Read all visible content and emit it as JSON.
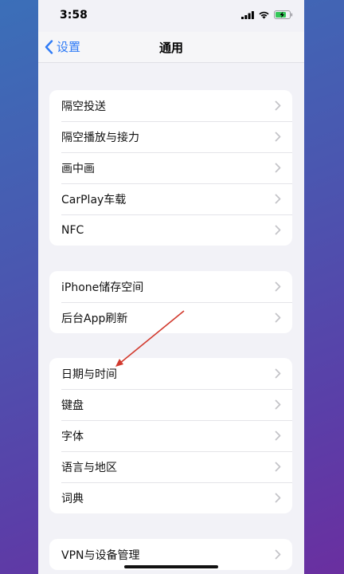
{
  "status_bar": {
    "time": "3:58"
  },
  "nav": {
    "back_label": "设置",
    "title": "通用"
  },
  "groups": [
    {
      "items": [
        "隔空投送",
        "隔空播放与接力",
        "画中画",
        "CarPlay车载",
        "NFC"
      ]
    },
    {
      "items": [
        "iPhone储存空间",
        "后台App刷新"
      ]
    },
    {
      "items": [
        "日期与时间",
        "键盘",
        "字体",
        "语言与地区",
        "词典"
      ]
    },
    {
      "items": [
        "VPN与设备管理"
      ]
    }
  ],
  "colors": {
    "accent": "#2f7bf6",
    "annotation_arrow": "#d23a2e",
    "battery": "#34c759"
  }
}
